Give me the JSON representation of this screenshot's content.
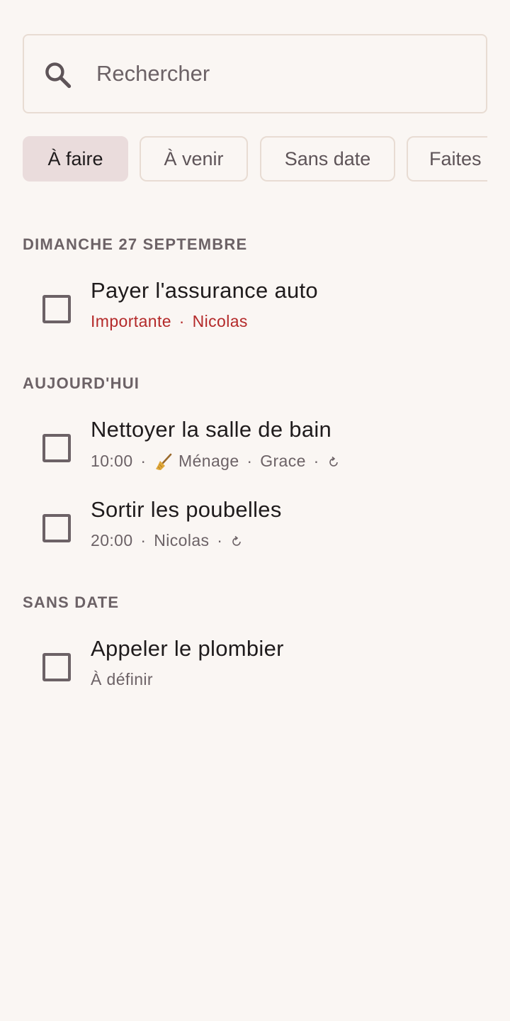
{
  "search": {
    "placeholder": "Rechercher",
    "value": ""
  },
  "filters": [
    {
      "label": "À faire",
      "selected": true
    },
    {
      "label": "À venir",
      "selected": false
    },
    {
      "label": "Sans date",
      "selected": false
    },
    {
      "label": "Faites",
      "selected": false
    }
  ],
  "sections": [
    {
      "header": "DIMANCHE 27 SEPTEMBRE",
      "tasks": [
        {
          "title": "Payer l'assurance auto",
          "priority": "Importante",
          "assignee": "Nicolas",
          "sep": "·"
        }
      ]
    },
    {
      "header": "AUJOURD'HUI",
      "tasks": [
        {
          "title": "Nettoyer la salle de bain",
          "time": "10:00",
          "category_icon": "broom-icon",
          "category": "Ménage",
          "assignee": "Grace",
          "recurring": true,
          "sep": "·"
        },
        {
          "title": "Sortir les poubelles",
          "time": "20:00",
          "assignee": "Nicolas",
          "recurring": true,
          "sep": "·"
        }
      ]
    },
    {
      "header": "SANS DATE",
      "tasks": [
        {
          "title": "Appeler le plombier",
          "note": "À définir"
        }
      ]
    }
  ],
  "colors": {
    "background": "#faf6f3",
    "important": "#b42a2a",
    "chip_selected": "#eadcdc",
    "outline": "#e8dcd3"
  }
}
